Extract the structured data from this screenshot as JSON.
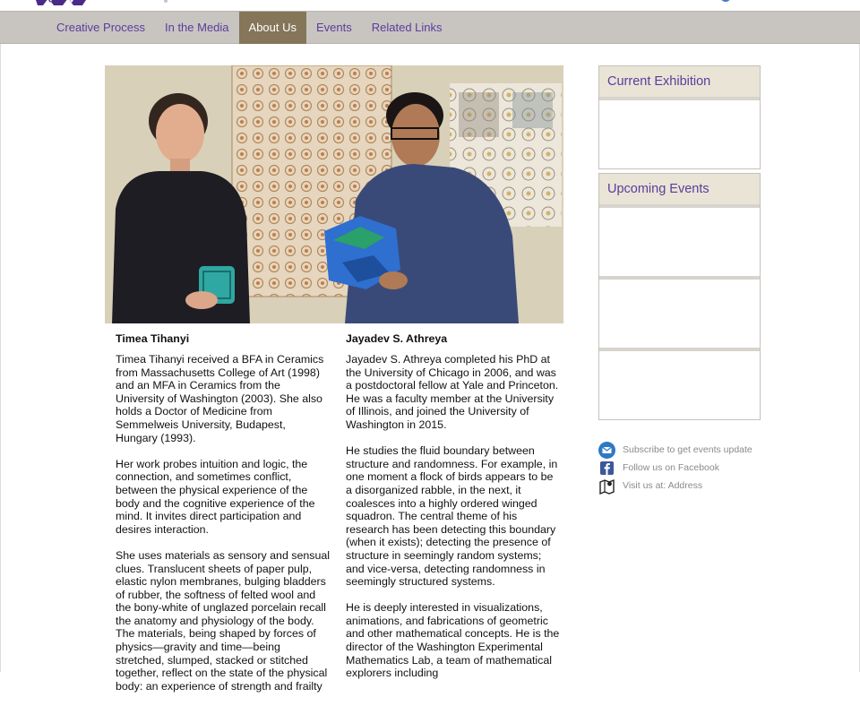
{
  "colors": {
    "brand_purple": "#5a3d9c",
    "nav_bg": "#c8c5c1",
    "nav_active": "#857559",
    "panel_header": "#eae4d6"
  },
  "nav": {
    "items": [
      {
        "label": "Creative Process",
        "active": false
      },
      {
        "label": "In the Media",
        "active": false
      },
      {
        "label": "About Us",
        "active": true
      },
      {
        "label": "Events",
        "active": false
      },
      {
        "label": "Related Links",
        "active": false
      }
    ]
  },
  "main": {
    "left": {
      "name": "Timea Tihanyi",
      "paragraphs": [
        "Timea Tihanyi received a BFA in Ceramics from Massachusetts College of Art (1998) and an MFA in Ceramics from the University of Washington (2003). She also holds a Doctor of Medicine from Semmelweis University, Budapest, Hungary (1993).",
        "Her work probes intuition and logic, the connection, and sometimes conflict, between the physical experience of the body and the cognitive experience of the mind. It invites direct participation and desires interaction.",
        "She uses materials as sensory and sensual clues. Translucent sheets of paper pulp, elastic nylon membranes, bulging bladders of rubber, the softness of felted wool and the bony-white of unglazed porcelain recall the anatomy and physiology of the body. The materials, being shaped by forces of physics—gravity and time—being stretched, slumped, stacked or stitched together, reflect on the state of the physical body: an experience of strength and frailty"
      ]
    },
    "right": {
      "name": "Jayadev S. Athreya",
      "paragraphs": [
        "Jayadev S. Athreya completed his PhD at the University of Chicago in 2006, and was a postdoctoral fellow at Yale and Princeton. He was a faculty member at the University of Illinois, and joined the University of Washington in 2015.",
        "He studies the fluid boundary between structure and randomness. For example, in one moment a flock of birds appears to be a disorganized rabble, in the next, it coalesces into a highly ordered winged squadron. The central theme of his research has been detecting this boundary (when it exists); detecting the presence of structure in seemingly random systems; and vice-versa, detecting randomness in seemingly structured systems.",
        "He is deeply interested in visualizations, animations, and fabrications of geometric and other mathematical concepts. He is the director of the Washington Experimental Mathematics Lab, a team of mathematical explorers including"
      ]
    }
  },
  "sidebar": {
    "current_exhibition": "Current Exhibition",
    "upcoming_events": "Upcoming Events",
    "links": [
      {
        "icon": "email-icon",
        "text": "Subscribe to get events update"
      },
      {
        "icon": "facebook-icon",
        "text": "Follow us on Facebook"
      },
      {
        "icon": "map-icon",
        "text": "Visit us at: Address"
      }
    ]
  }
}
